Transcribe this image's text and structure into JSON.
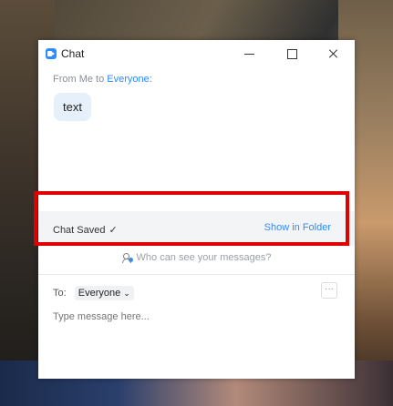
{
  "window": {
    "title": "Chat",
    "icon": "zoom-app-icon"
  },
  "message": {
    "from_prefix": "From Me to",
    "to_who": "Everyone:",
    "text": "text"
  },
  "saved_bar": {
    "status": "Chat Saved",
    "check_glyph": "✓",
    "action": "Show in Folder"
  },
  "privacy": {
    "label": "Who can see your messages?"
  },
  "compose": {
    "to_label": "To:",
    "recipient": "Everyone",
    "more_glyph": "···",
    "placeholder": "Type message here..."
  },
  "colors": {
    "accent": "#2d8cff",
    "highlight": "#e00000"
  }
}
